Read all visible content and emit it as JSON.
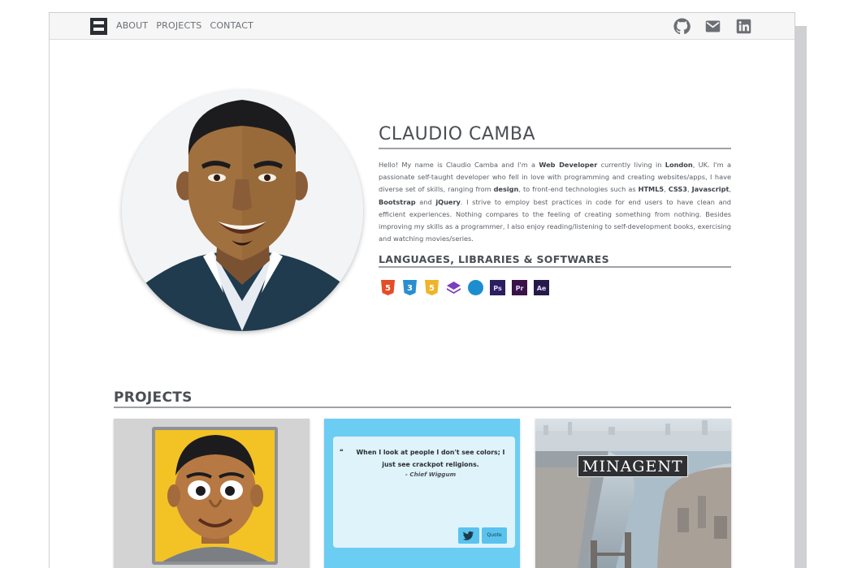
{
  "nav": {
    "links": [
      "ABOUT",
      "PROJECTS",
      "CONTACT"
    ],
    "icons": [
      "github-icon",
      "envelope-icon",
      "linkedin-icon"
    ]
  },
  "profile": {
    "name": "CLAUDIO CAMBA",
    "bio": [
      {
        "t": "Hello! My name is Claudio Camba and I'm a "
      },
      {
        "t": "Web Developer",
        "b": true
      },
      {
        "t": " currently living in "
      },
      {
        "t": "London",
        "b": true
      },
      {
        "t": ", UK. I'm a passionate self-taught developer who fell in love with programming and creating websites/apps, I have diverse set of skills, ranging from "
      },
      {
        "t": "design",
        "b": true
      },
      {
        "t": ", to front-end technologies such as "
      },
      {
        "t": "HTML5",
        "b": true
      },
      {
        "t": ", "
      },
      {
        "t": "CSS3",
        "b": true
      },
      {
        "t": ", "
      },
      {
        "t": "Javascript",
        "b": true
      },
      {
        "t": ", "
      },
      {
        "t": "Bootstrap",
        "b": true
      },
      {
        "t": " and "
      },
      {
        "t": "jQuery",
        "b": true
      },
      {
        "t": ". I strive to employ best practices in code for end users to have clean and efficient experiences. Nothing compares to the feeling of creating something from nothing. Besides improving my skills as a programmer, I also enjoy reading/listening to self-development books, exercising and watching movies/series."
      }
    ],
    "skills_heading": "LANGUAGES, LIBRARIES & SOFTWARES",
    "skills": [
      {
        "icon": "html5-icon",
        "label": "5",
        "color": "#e44d26"
      },
      {
        "icon": "css3-icon",
        "label": "3",
        "color": "#2a8fcf"
      },
      {
        "icon": "javascript-icon",
        "label": "5",
        "color": "#f0b429"
      },
      {
        "icon": "bootstrap-icon",
        "label": "",
        "color": "#7b3ebd"
      },
      {
        "icon": "jquery-icon",
        "label": "",
        "color": "#1b8ed0"
      },
      {
        "icon": "photoshop-icon",
        "label": "Ps",
        "color": "#2b1f5e"
      },
      {
        "icon": "premiere-icon",
        "label": "Pr",
        "color": "#3b1246"
      },
      {
        "icon": "after-effects-icon",
        "label": "Ae",
        "color": "#261a4a"
      }
    ]
  },
  "projects": {
    "title": "PROJECTS",
    "quote_card": {
      "text": "When I look at people I don't see colors; I just see crackpot religions.",
      "author": "- Chief Wiggum",
      "quote_button": "Quote"
    },
    "minagent_card": {
      "label": "MINAGENT"
    }
  },
  "colors": {
    "accent_rule": "#9ea2a7",
    "text": "#5a5f66",
    "quote_bg": "#6ccdf3"
  }
}
